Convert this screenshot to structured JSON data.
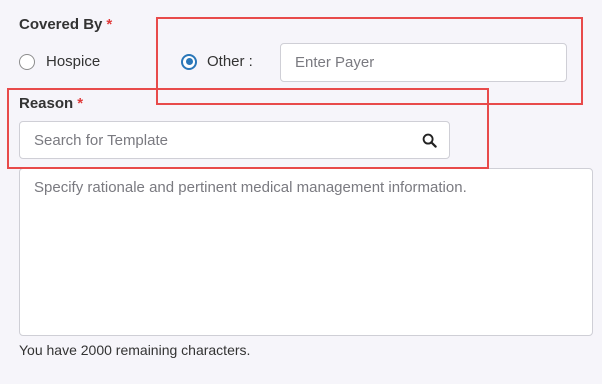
{
  "covered_by": {
    "label": "Covered By",
    "required_mark": "*",
    "options": [
      {
        "label": "Hospice",
        "selected": false
      },
      {
        "label": "Other :",
        "selected": true
      }
    ],
    "payer_placeholder": "Enter Payer"
  },
  "reason": {
    "label": "Reason",
    "required_mark": "*",
    "search_placeholder": "Search for Template",
    "rationale_placeholder": "Specify rationale and pertinent medical management information.",
    "remaining_text": "You have 2000 remaining characters."
  },
  "colors": {
    "accent": "#2a77b9",
    "required": "#e03a3a",
    "highlight": "#e84a4a"
  },
  "icons": {
    "search": "search-icon"
  }
}
